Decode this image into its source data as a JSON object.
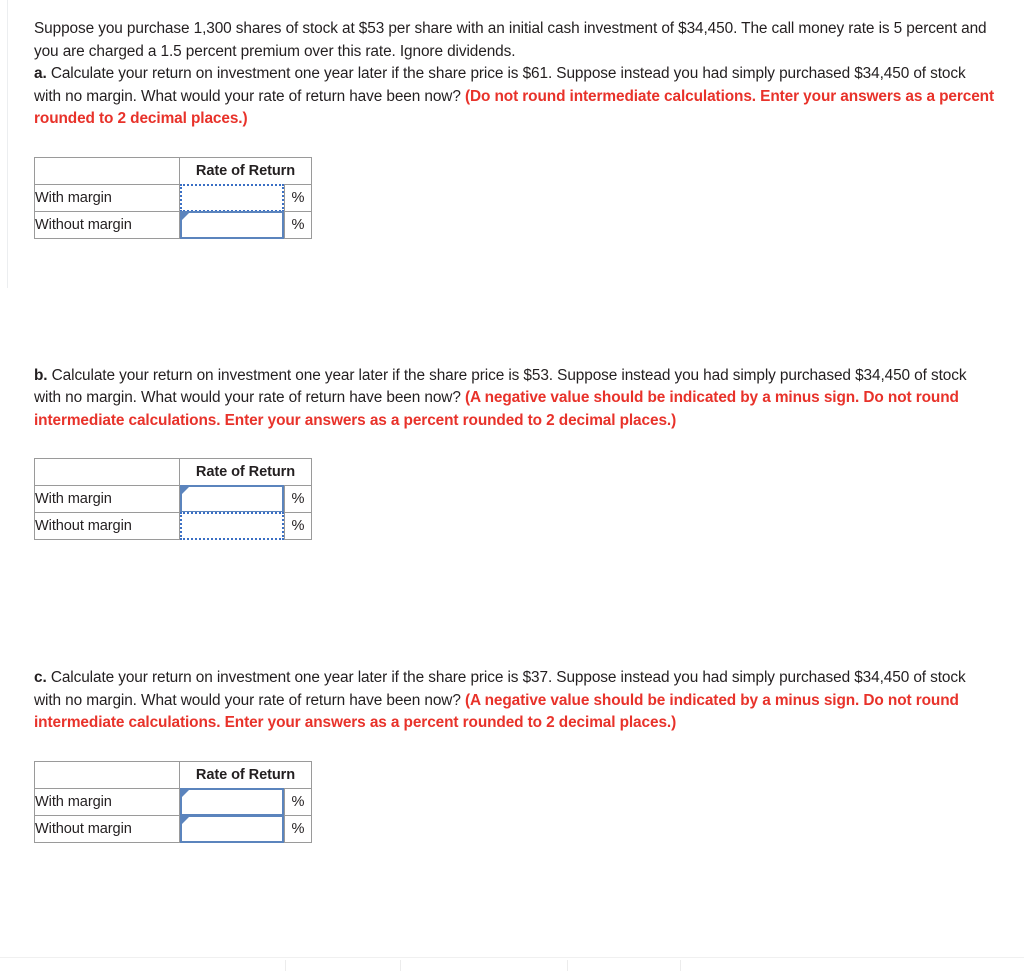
{
  "colors": {
    "text": "#231f20",
    "hint_red": "#e8322a",
    "header_fill": "#d5dae2",
    "cell_border": "#9a9a9a",
    "active_border": "#5b84bd",
    "selection_border": "#3a6fc4"
  },
  "problem": {
    "statement": "Suppose you purchase 1,300 shares of stock at $53 per share with an initial cash investment of $34,450. The call money rate is 5 percent and you are charged a 1.5 percent premium over this rate. Ignore dividends."
  },
  "parts": [
    {
      "label": "a.",
      "question": " Calculate your return on investment one year later if the share price is $61. Suppose instead you had simply purchased $34,450 of stock with no margin. What would your rate of return have been now? ",
      "hint": "(Do not round intermediate calculations. Enter your answers as a percent rounded to 2 decimal places.)",
      "table": {
        "header_blank": "",
        "header_value": "Rate of Return",
        "rows": [
          {
            "label": "With margin",
            "value": "",
            "unit": "%",
            "state": "dotted"
          },
          {
            "label": "Without margin",
            "value": "",
            "unit": "%",
            "state": "solid"
          }
        ]
      }
    },
    {
      "label": "b.",
      "question": " Calculate your return on investment one year later if the share price is $53. Suppose instead you had simply purchased $34,450 of stock with no margin. What would your rate of return have been now? ",
      "hint": "(A negative value should be indicated by a minus sign. Do not round intermediate calculations. Enter your answers as a percent rounded to 2 decimal places.)",
      "table": {
        "header_blank": "",
        "header_value": "Rate of Return",
        "rows": [
          {
            "label": "With margin",
            "value": "",
            "unit": "%",
            "state": "solid"
          },
          {
            "label": "Without margin",
            "value": "",
            "unit": "%",
            "state": "dotted"
          }
        ]
      }
    },
    {
      "label": "c.",
      "question": " Calculate your return on investment one year later if the share price is $37. Suppose instead you had simply purchased $34,450 of stock with no margin. What would your rate of return have been now? ",
      "hint": "(A negative value should be indicated by a minus sign. Do not round intermediate calculations. Enter your answers as a percent rounded to 2 decimal places.)",
      "table": {
        "header_blank": "",
        "header_value": "Rate of Return",
        "rows": [
          {
            "label": "With margin",
            "value": "",
            "unit": "%",
            "state": "solid"
          },
          {
            "label": "Without margin",
            "value": "",
            "unit": "%",
            "state": "solid"
          }
        ]
      }
    }
  ]
}
